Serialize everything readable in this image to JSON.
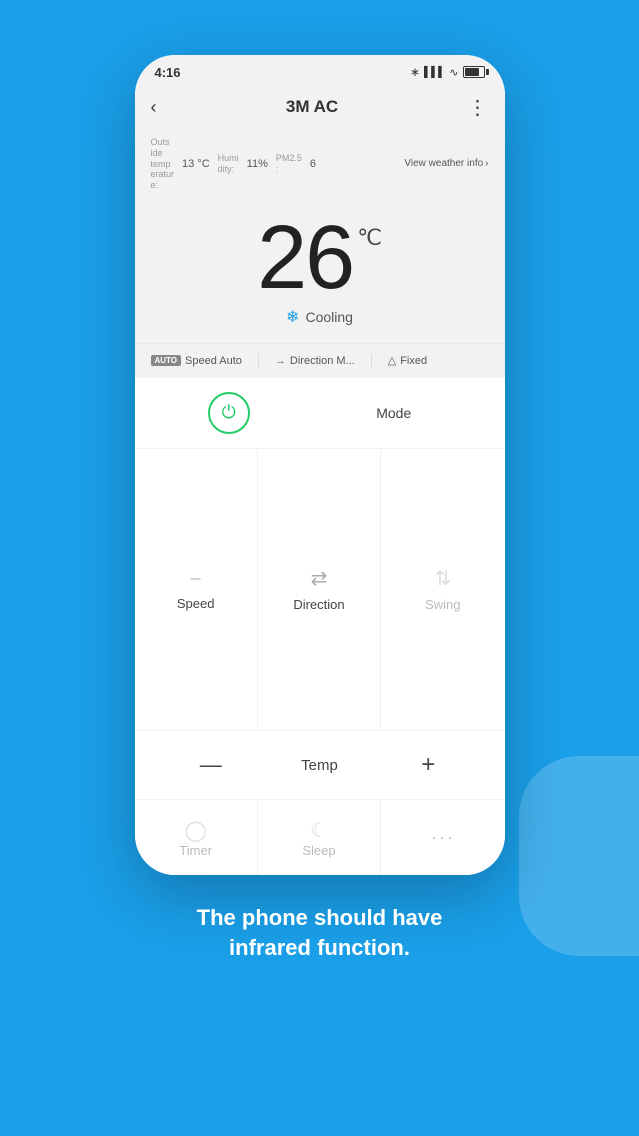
{
  "background": "#1a9fe8",
  "footer": {
    "line1": "The phone should have",
    "line2": "infrared function."
  },
  "phone": {
    "status_bar": {
      "time": "4:16",
      "icons": "bluetooth signal wifi battery"
    },
    "nav": {
      "back_label": "‹",
      "title": "3M AC",
      "more_label": "⋮"
    },
    "weather": {
      "outside_temp_label": "Outside temperature:",
      "temp_value": "13 °C",
      "humidity_label": "Humidity:",
      "humidity_value": "11%",
      "pm_label": "PM2.5:",
      "pm_value": "6",
      "view_label": "View weather info",
      "view_arrow": "›"
    },
    "temperature": {
      "value": "26",
      "unit": "℃",
      "mode_icon": "❄",
      "mode_label": "Cooling"
    },
    "ac_status": {
      "speed_tag": "AUTO",
      "speed_label": "Speed Auto",
      "direction_arrow": "→",
      "direction_label": "Direction M...",
      "fixed_icon": "△",
      "fixed_label": "Fixed"
    },
    "controls": {
      "power_label": "",
      "mode_label": "Mode",
      "speed_label": "Speed",
      "direction_label": "Direction",
      "swing_label": "Swing",
      "temp_minus": "—",
      "temp_label": "Temp",
      "temp_plus": "+",
      "timer_label": "Timer",
      "sleep_label": "Sleep",
      "more_label": "···"
    }
  }
}
